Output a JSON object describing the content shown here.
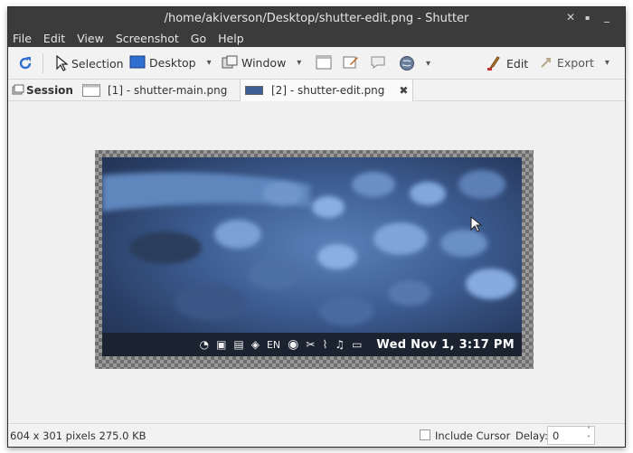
{
  "window": {
    "title": "/home/akiverson/Desktop/shutter-edit.png - Shutter"
  },
  "menu": [
    "File",
    "Edit",
    "View",
    "Screenshot",
    "Go",
    "Help"
  ],
  "toolbar": {
    "selection_label": "Selection",
    "desktop_label": "Desktop",
    "window_label": "Window",
    "edit_label": "Edit",
    "export_label": "Export"
  },
  "tabs": {
    "session_label": "Session",
    "tab1_label": "[1] - shutter-main.png",
    "tab2_label": "[2] - shutter-edit.png"
  },
  "screenshot": {
    "panel_lang": "EN",
    "panel_clock": "Wed Nov  1,  3:17 PM"
  },
  "status": {
    "info": "604 x 301 pixels  275.0 KB",
    "include_cursor_label": "Include Cursor",
    "delay_label": "Delay:",
    "delay_value": "0"
  },
  "colors": {
    "accent": "#2f6fd1",
    "titlebar": "#3b3b3b"
  }
}
